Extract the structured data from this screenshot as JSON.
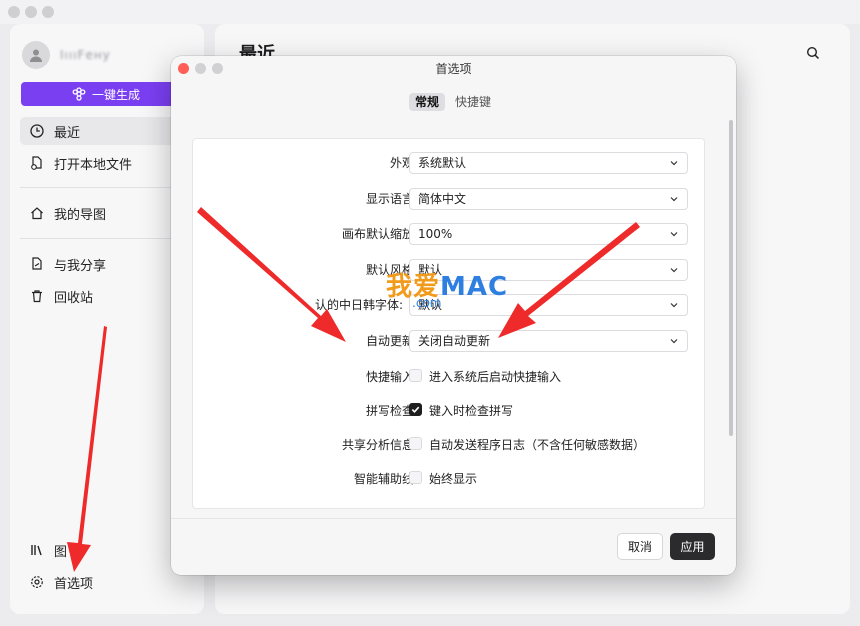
{
  "window": {
    "traffic_lights": [
      "close",
      "minimize",
      "zoom"
    ]
  },
  "sidebar": {
    "username": "IıııFену",
    "generate_button": "一键生成",
    "items": [
      {
        "label": "最近",
        "icon": "clock-icon",
        "active": true
      },
      {
        "label": "打开本地文件",
        "icon": "open-file-icon"
      },
      {
        "label": "我的导图",
        "icon": "home-icon"
      },
      {
        "label": "与我分享",
        "icon": "shared-file-icon"
      },
      {
        "label": "回收站",
        "icon": "trash-icon"
      }
    ],
    "bottom_items": [
      {
        "label": "图",
        "icon": "library-icon"
      },
      {
        "label": "首选项",
        "icon": "gear-icon"
      }
    ]
  },
  "main": {
    "title": "最近"
  },
  "preferences": {
    "title": "首选项",
    "tabs": [
      {
        "label": "常规",
        "active": true
      },
      {
        "label": "快捷键",
        "active": false
      }
    ],
    "selects": [
      {
        "label": "外观:",
        "value": "系统默认"
      },
      {
        "label": "显示语言:",
        "value": "简体中文"
      },
      {
        "label": "画布默认缩放:",
        "value": "100%"
      },
      {
        "label": "默认风格:",
        "value": "默认"
      },
      {
        "label": "认的中日韩字体:",
        "value": "默认"
      },
      {
        "label": "自动更新:",
        "value": "关闭自动更新"
      }
    ],
    "checkboxes": [
      {
        "label": "快捷输入:",
        "text": "进入系统后启动快捷输入",
        "checked": false
      },
      {
        "label": "拼写检查:",
        "text": "键入时检查拼写",
        "checked": true
      },
      {
        "label": "共享分析信息:",
        "text": "自动发送程序日志（不含任何敏感数据）",
        "checked": false
      },
      {
        "label": "智能辅助线:",
        "text": "始终显示",
        "checked": false
      }
    ],
    "cancel_label": "取消",
    "apply_label": "应用"
  },
  "watermark": {
    "big_left": "我爱",
    "big_right": "MAC",
    "small": ".com"
  },
  "colors": {
    "accent_purple": "#7b3ff2",
    "apply_button": "#2b2b2e",
    "annotation_arrow": "#ee2a2a"
  }
}
